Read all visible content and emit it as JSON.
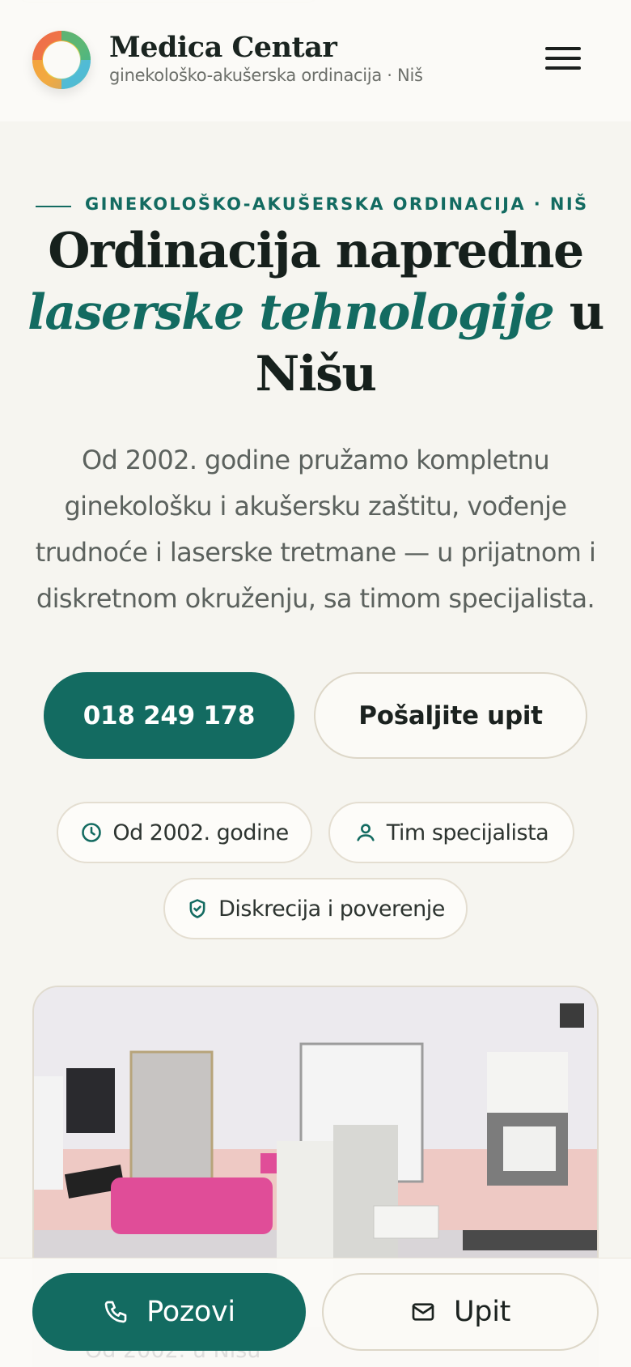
{
  "header": {
    "brand_name": "Medica Centar",
    "brand_subtitle": "ginekološko-akušerska ordinacija · Niš",
    "menu_icon": "hamburger-menu-icon"
  },
  "hero": {
    "eyebrow": "GINEKOLOŠKO-AKUŠERSKA ORDINACIJA · NIŠ",
    "title_part1": "Ordinacija napredne",
    "title_accent": "laserske tehnologije",
    "title_part2": "u Nišu",
    "lead": "Od 2002. godine pružamo kompletnu ginekološku i akušersku zaštitu, vođenje trudnoće i laserske tretmane — u prijatnom i diskretnom okruženju, sa timom specijalista.",
    "call_button": "018 249 178",
    "inquiry_button": "Pošaljite upit"
  },
  "chips": [
    {
      "label": "Od 2002. godine",
      "icon": "clock-icon"
    },
    {
      "label": "Tim specijalista",
      "icon": "user-icon"
    },
    {
      "label": "Diskrecija i poverenje",
      "icon": "shield-check-icon"
    }
  ],
  "photo": {
    "caption_peek": "Od 2002. u Nišu"
  },
  "bottom_bar": {
    "call_label": "Pozovi",
    "call_icon": "phone-icon",
    "upit_label": "Upit",
    "upit_icon": "mail-icon"
  },
  "colors": {
    "accent": "#136b61",
    "background": "#f6f5f0",
    "text": "#16201c"
  }
}
